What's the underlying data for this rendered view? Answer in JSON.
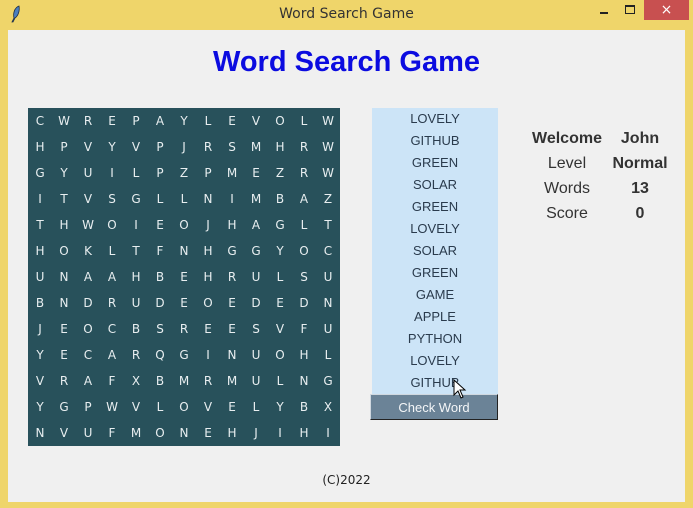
{
  "window": {
    "title": "Word Search Game",
    "controls": {
      "minimize": "minimize",
      "maximize": "maximize",
      "close": "×"
    }
  },
  "heading": "Word Search Game",
  "grid": [
    [
      "C",
      "W",
      "R",
      "E",
      "P",
      "A",
      "Y",
      "L",
      "E",
      "V",
      "O",
      "L",
      "W"
    ],
    [
      "H",
      "P",
      "V",
      "Y",
      "V",
      "P",
      "J",
      "R",
      "S",
      "M",
      "H",
      "R",
      "W"
    ],
    [
      "G",
      "Y",
      "U",
      "I",
      "L",
      "P",
      "Z",
      "P",
      "M",
      "E",
      "Z",
      "R",
      "W"
    ],
    [
      "I",
      "T",
      "V",
      "S",
      "G",
      "L",
      "L",
      "N",
      "I",
      "M",
      "B",
      "A",
      "Z"
    ],
    [
      "T",
      "H",
      "W",
      "O",
      "I",
      "E",
      "O",
      "J",
      "H",
      "A",
      "G",
      "L",
      "T"
    ],
    [
      "H",
      "O",
      "K",
      "L",
      "T",
      "F",
      "N",
      "H",
      "G",
      "G",
      "Y",
      "O",
      "C"
    ],
    [
      "U",
      "N",
      "A",
      "A",
      "H",
      "B",
      "E",
      "H",
      "R",
      "U",
      "L",
      "S",
      "U"
    ],
    [
      "B",
      "N",
      "D",
      "R",
      "U",
      "D",
      "E",
      "O",
      "E",
      "D",
      "E",
      "D",
      "N"
    ],
    [
      "J",
      "E",
      "O",
      "C",
      "B",
      "S",
      "R",
      "E",
      "E",
      "S",
      "V",
      "F",
      "U"
    ],
    [
      "Y",
      "E",
      "C",
      "A",
      "R",
      "Q",
      "G",
      "I",
      "N",
      "U",
      "O",
      "H",
      "L"
    ],
    [
      "V",
      "R",
      "A",
      "F",
      "X",
      "B",
      "M",
      "R",
      "M",
      "U",
      "L",
      "N",
      "G"
    ],
    [
      "Y",
      "G",
      "P",
      "W",
      "V",
      "L",
      "O",
      "V",
      "E",
      "L",
      "Y",
      "B",
      "X"
    ],
    [
      "N",
      "V",
      "U",
      "F",
      "M",
      "O",
      "N",
      "E",
      "H",
      "J",
      "I",
      "H",
      "I"
    ]
  ],
  "word_list": [
    "LOVELY",
    "GITHUB",
    "GREEN",
    "SOLAR",
    "GREEN",
    "LOVELY",
    "SOLAR",
    "GREEN",
    "GAME",
    "APPLE",
    "PYTHON",
    "LOVELY",
    "GITHUB"
  ],
  "check_button": "Check Word",
  "info": {
    "welcome_label": "Welcome",
    "welcome_value": "John",
    "level_label": "Level",
    "level_value": "Normal",
    "words_label": "Words",
    "words_value": "13",
    "score_label": "Score",
    "score_value": "0"
  },
  "footer": "(C)2022"
}
